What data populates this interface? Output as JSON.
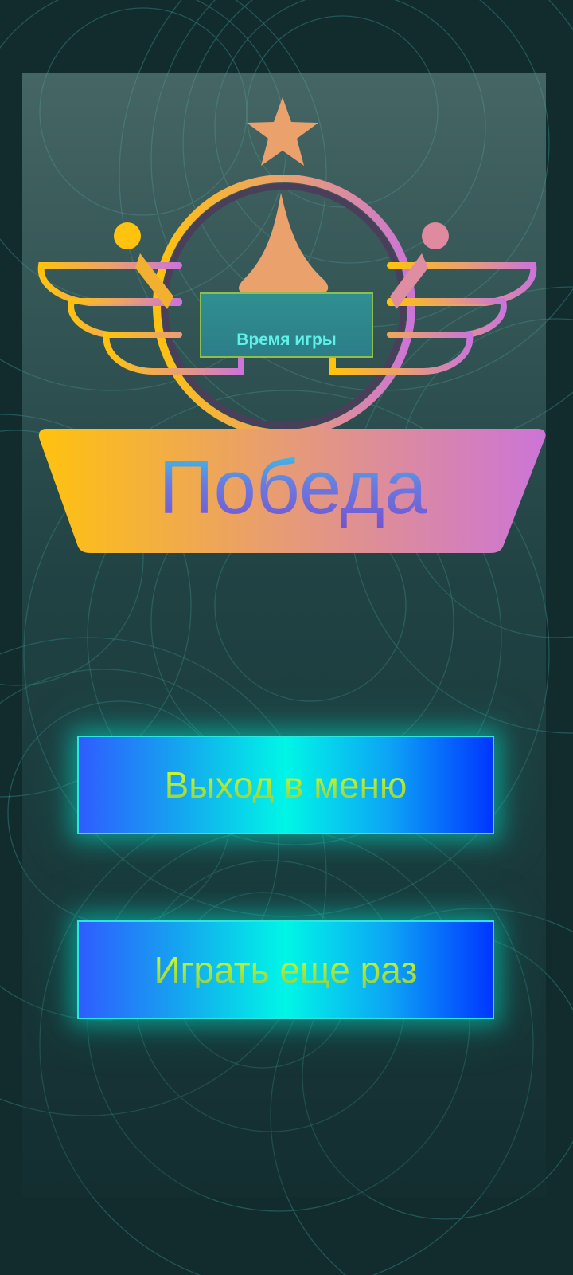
{
  "result": {
    "title": "Победа",
    "time_label": "Время игры"
  },
  "buttons": {
    "menu_label": "Выход в меню",
    "replay_label": "Играть еще раз"
  },
  "icons": [
    "star-icon",
    "winged-emblem-icon"
  ],
  "colors": {
    "background": "#122b2d",
    "emblem_gradient_start": "#ffc20e",
    "emblem_gradient_end": "#cc74d8",
    "title_gradient_top": "#16eef0",
    "title_gradient_bottom": "#7a3fc8",
    "button_gradient_center": "#00f6e6",
    "button_gradient_edge": "#0036ff",
    "button_text": "#c8f53a"
  }
}
